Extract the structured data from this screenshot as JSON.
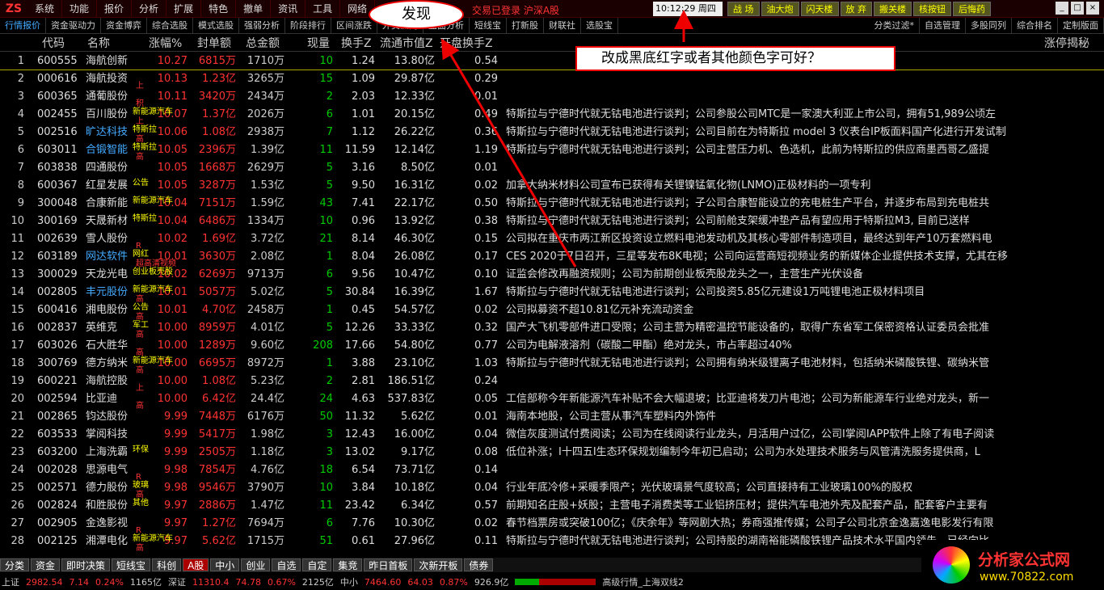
{
  "menu": {
    "logo": "ZS",
    "items": [
      "系统",
      "功能",
      "报价",
      "分析",
      "扩展",
      "特色",
      "撤单",
      "资讯",
      "工具",
      "网络"
    ],
    "login_status": "交易已登录  沪深A股",
    "clock": "10:12:29 周四",
    "quick_buttons": [
      "战 场",
      "油大炮",
      "闪天楼",
      "放 弃",
      "搬关楼",
      "核按钮",
      "后悔药"
    ]
  },
  "tabs": {
    "left": [
      "行情报价",
      "资金驱动力",
      "资金博弈",
      "综合选股",
      "模式选股",
      "强弱分析",
      "阶段排行",
      "区间涨跌",
      "外资流向",
      "盘面分析",
      "短线宝",
      "打新股",
      "财联社",
      "选股宝"
    ],
    "right": [
      "分类过滤*",
      "自选管理",
      "多股同列",
      "综合排名",
      "定制版面"
    ]
  },
  "columns": [
    "代码",
    "名称",
    "涨幅%",
    "封单额",
    "总金额",
    "现量",
    "换手Z",
    "流通市值Z",
    "开盘换手Z",
    "涨停揭秘"
  ],
  "rows": [
    {
      "idx": "1",
      "code": "600555",
      "name": "海航创新",
      "pct": "10.27",
      "seal": "6815万",
      "amt": "1710万",
      "vol": "10",
      "turn": "1.24",
      "mcap": "13.80亿",
      "open": "0.54",
      "note": "",
      "tag": "",
      "tag2": "",
      "name_color": "#ddd"
    },
    {
      "idx": "2",
      "code": "000616",
      "name": "海航投资",
      "pct": "10.13",
      "seal": "1.23亿",
      "amt": "3265万",
      "vol": "15",
      "turn": "1.09",
      "mcap": "29.87亿",
      "open": "0.29",
      "note": "",
      "tag": "",
      "tag2": "上",
      "name_color": "#ddd"
    },
    {
      "idx": "3",
      "code": "600365",
      "name": "通葡股份",
      "pct": "10.11",
      "seal": "3420万",
      "amt": "2434万",
      "vol": "2",
      "turn": "2.03",
      "mcap": "12.33亿",
      "open": "0.01",
      "note": "",
      "tag": "",
      "tag2": "积",
      "name_color": "#ddd"
    },
    {
      "idx": "4",
      "code": "002455",
      "name": "百川股份",
      "pct": "10.07",
      "seal": "1.37亿",
      "amt": "2026万",
      "vol": "6",
      "turn": "1.01",
      "mcap": "20.15亿",
      "open": "0.49",
      "note": "特斯拉与宁德时代就无钴电池进行谈判；公司参股公司MTC是一家澳大利亚上市公司，拥有51,989公顷左",
      "tag": "新能源汽车",
      "tag2": "上",
      "name_color": "#ddd"
    },
    {
      "idx": "5",
      "code": "002516",
      "name": "旷达科技",
      "pct": "10.06",
      "seal": "1.08亿",
      "amt": "2938万",
      "vol": "7",
      "turn": "1.12",
      "mcap": "26.22亿",
      "open": "0.36",
      "note": "特斯拉与宁德时代就无钴电池进行谈判；公司目前在为特斯拉 model 3 仪表台IP板面料国产化进行开发试制",
      "tag": "特斯拉",
      "tag2": "高",
      "name_color": "#4af"
    },
    {
      "idx": "6",
      "code": "603011",
      "name": "合锻智能",
      "pct": "10.05",
      "seal": "2396万",
      "amt": "1.39亿",
      "vol": "11",
      "turn": "11.59",
      "mcap": "12.14亿",
      "open": "1.19",
      "note": "特斯拉与宁德时代就无钴电池进行谈判；公司主营压力机、色选机，此前为特斯拉的供应商墨西哥乙盛提",
      "tag": "特斯拉",
      "tag2": "高",
      "name_color": "#4af"
    },
    {
      "idx": "7",
      "code": "603838",
      "name": "四通股份",
      "pct": "10.05",
      "seal": "1668万",
      "amt": "2629万",
      "vol": "5",
      "turn": "3.16",
      "mcap": "8.50亿",
      "open": "0.01",
      "note": "",
      "tag": "",
      "tag2": "",
      "name_color": "#ddd"
    },
    {
      "idx": "8",
      "code": "600367",
      "name": "红星发展",
      "pct": "10.05",
      "seal": "3287万",
      "amt": "1.53亿",
      "vol": "5",
      "turn": "9.50",
      "mcap": "16.31亿",
      "open": "0.02",
      "note": "加拿大纳米材料公司宣布已获得有关锂镍锰氧化物(LNMO)正极材料的一项专利",
      "tag": "公告",
      "tag2": "",
      "name_color": "#ddd"
    },
    {
      "idx": "9",
      "code": "300048",
      "name": "合康新能",
      "pct": "10.04",
      "seal": "7151万",
      "amt": "1.59亿",
      "vol": "43",
      "turn": "7.41",
      "mcap": "22.17亿",
      "open": "0.50",
      "note": "特斯拉与宁德时代就无钴电池进行谈判；子公司合康智能设立的充电桩生产平台，并逐步布局到充电桩共",
      "tag": "新能源汽车",
      "tag2": "",
      "name_color": "#ddd"
    },
    {
      "idx": "10",
      "code": "300169",
      "name": "天晟新材",
      "pct": "10.04",
      "seal": "6486万",
      "amt": "1334万",
      "vol": "10",
      "turn": "0.96",
      "mcap": "13.92亿",
      "open": "0.38",
      "note": "特斯拉与宁德时代就无钴电池进行谈判；公司前舱支架缓冲垫产品有望应用于特斯拉M3, 目前已送样",
      "tag": "特斯拉",
      "tag2": "",
      "name_color": "#ddd"
    },
    {
      "idx": "11",
      "code": "002639",
      "name": "雪人股份",
      "pct": "10.02",
      "seal": "1.69亿",
      "amt": "3.72亿",
      "vol": "21",
      "turn": "8.14",
      "mcap": "46.30亿",
      "open": "0.15",
      "note": "公司拟在重庆市两江新区投资设立燃料电池发动机及其核心零部件制造项目，最终达到年产10万套燃料电",
      "tag": "",
      "tag2": "R",
      "name_color": "#ddd"
    },
    {
      "idx": "12",
      "code": "603189",
      "name": "网达软件",
      "pct": "10.01",
      "seal": "3630万",
      "amt": "2.08亿",
      "vol": "1",
      "turn": "8.04",
      "mcap": "26.08亿",
      "open": "0.17",
      "note": "CES 2020于7日召开，三星等发布8K电视；公司向运营商短视频业务的新媒体企业提供技术支撑，尤其在移",
      "tag": "网红",
      "tag2": "超高清视频",
      "name_color": "#4af"
    },
    {
      "idx": "13",
      "code": "300029",
      "name": "天龙光电",
      "pct": "10.02",
      "seal": "6269万",
      "amt": "9713万",
      "vol": "6",
      "turn": "9.56",
      "mcap": "10.47亿",
      "open": "0.10",
      "note": "证监会修改再融资规则；公司为前期创业板壳股龙头之一，主营生产光伏设备",
      "tag": "创业板壳股",
      "tag2": "",
      "name_color": "#ddd"
    },
    {
      "idx": "14",
      "code": "002805",
      "name": "丰元股份",
      "pct": "10.01",
      "seal": "5057万",
      "amt": "5.02亿",
      "vol": "5",
      "turn": "30.84",
      "mcap": "16.39亿",
      "open": "1.67",
      "note": "特斯拉与宁德时代就无钴电池进行谈判；公司投资5.85亿元建设1万吨锂电池正极材料项目",
      "tag": "新能源汽车",
      "tag2": "高",
      "name_color": "#4af"
    },
    {
      "idx": "15",
      "code": "600416",
      "name": "湘电股份",
      "pct": "10.01",
      "seal": "4.70亿",
      "amt": "2458万",
      "vol": "1",
      "turn": "0.45",
      "mcap": "54.57亿",
      "open": "0.02",
      "note": "公司拟募资不超10.81亿元补充流动资金",
      "tag": "公告",
      "tag2": "高",
      "name_color": "#ddd"
    },
    {
      "idx": "16",
      "code": "002837",
      "name": "英维克",
      "pct": "10.00",
      "seal": "8959万",
      "amt": "4.01亿",
      "vol": "5",
      "turn": "12.26",
      "mcap": "33.33亿",
      "open": "0.32",
      "note": "国产大飞机零部件进口受限；公司主营为精密温控节能设备的，取得广东省军工保密资格认证委员会批准",
      "tag": "军工",
      "tag2": "高",
      "name_color": "#ddd"
    },
    {
      "idx": "17",
      "code": "603026",
      "name": "石大胜华",
      "pct": "10.00",
      "seal": "1289万",
      "amt": "9.60亿",
      "vol": "208",
      "turn": "17.66",
      "mcap": "54.80亿",
      "open": "0.77",
      "note": "公司为电解液溶剂（碳酸二甲酯）绝对龙头，市占率超过40%",
      "tag": "",
      "tag2": "高",
      "name_color": "#ddd"
    },
    {
      "idx": "18",
      "code": "300769",
      "name": "德方纳米",
      "pct": "10.00",
      "seal": "6695万",
      "amt": "8972万",
      "vol": "1",
      "turn": "3.88",
      "mcap": "23.10亿",
      "open": "1.03",
      "note": "特斯拉与宁德时代就无钴电池进行谈判；公司拥有纳米级锂离子电池材料，包括纳米磷酸铁锂、碳纳米管",
      "tag": "新能源汽车",
      "tag2": "高",
      "name_color": "#ddd"
    },
    {
      "idx": "19",
      "code": "600221",
      "name": "海航控股",
      "pct": "10.00",
      "seal": "1.08亿",
      "amt": "5.23亿",
      "vol": "2",
      "turn": "2.81",
      "mcap": "186.51亿",
      "open": "0.24",
      "note": "",
      "tag": "",
      "tag2": "上",
      "name_color": "#ddd"
    },
    {
      "idx": "20",
      "code": "002594",
      "name": "比亚迪",
      "pct": "10.00",
      "seal": "6.42亿",
      "amt": "24.4亿",
      "vol": "24",
      "turn": "4.63",
      "mcap": "537.83亿",
      "open": "0.05",
      "note": "工信部称今年新能源汽车补贴不会大幅退坡；比亚迪将发刀片电池；公司为新能源车行业绝对龙头，新一",
      "tag": "",
      "tag2": "高",
      "name_color": "#ddd"
    },
    {
      "idx": "21",
      "code": "002865",
      "name": "钧达股份",
      "pct": "9.99",
      "seal": "7448万",
      "amt": "6176万",
      "vol": "50",
      "turn": "11.32",
      "mcap": "5.62亿",
      "open": "0.01",
      "note": "海南本地股，公司主营从事汽车塑料内外饰件",
      "tag": "",
      "tag2": "",
      "name_color": "#ddd"
    },
    {
      "idx": "22",
      "code": "603533",
      "name": "掌阅科技",
      "pct": "9.99",
      "seal": "5417万",
      "amt": "1.98亿",
      "vol": "3",
      "turn": "12.43",
      "mcap": "16.00亿",
      "open": "0.04",
      "note": "微信灰度测试付费阅读；公司为在线阅读行业龙头，月活用户过亿，公司I掌阅IAPP软件上除了有电子阅读",
      "tag": "",
      "tag2": "",
      "name_color": "#ddd"
    },
    {
      "idx": "23",
      "code": "603200",
      "name": "上海洗霸",
      "pct": "9.99",
      "seal": "2505万",
      "amt": "1.18亿",
      "vol": "3",
      "turn": "13.02",
      "mcap": "9.17亿",
      "open": "0.08",
      "note": "低位补涨；I十四五I生态环保规划编制今年初已启动；公司为水处理技术服务与风管清洗服务提供商，L",
      "tag": "环保",
      "tag2": "",
      "name_color": "#ddd"
    },
    {
      "idx": "24",
      "code": "002028",
      "name": "思源电气",
      "pct": "9.98",
      "seal": "7854万",
      "amt": "4.76亿",
      "vol": "18",
      "turn": "6.54",
      "mcap": "73.71亿",
      "open": "0.14",
      "note": "",
      "tag": "",
      "tag2": "R",
      "name_color": "#ddd"
    },
    {
      "idx": "25",
      "code": "002571",
      "name": "德力股份",
      "pct": "9.98",
      "seal": "9546万",
      "amt": "3790万",
      "vol": "10",
      "turn": "3.84",
      "mcap": "10.18亿",
      "open": "0.04",
      "note": "行业年底冷修+采暖季限产；光伏玻璃景气度较高；公司直接持有工业玻璃100%的股权",
      "tag": "玻璃",
      "tag2": "高",
      "name_color": "#ddd"
    },
    {
      "idx": "26",
      "code": "002824",
      "name": "和胜股份",
      "pct": "9.97",
      "seal": "2886万",
      "amt": "1.47亿",
      "vol": "11",
      "turn": "23.42",
      "mcap": "6.34亿",
      "open": "0.57",
      "note": "前期知名庄股+妖股；主营电子消费类等工业铝挤压材；提供汽车电池外壳及配套产品，配套客户主要有",
      "tag": "其他",
      "tag2": "",
      "name_color": "#ddd"
    },
    {
      "idx": "27",
      "code": "002905",
      "name": "金逸影视",
      "pct": "9.97",
      "seal": "1.27亿",
      "amt": "7694万",
      "vol": "6",
      "turn": "7.76",
      "mcap": "10.30亿",
      "open": "0.02",
      "note": "春节档票房或突破100亿；《庆余年》等网剧大热；券商强推传媒；公司子公司北京金逸嘉逸电影发行有限",
      "tag": "",
      "tag2": "R",
      "name_color": "#ddd"
    },
    {
      "idx": "28",
      "code": "002125",
      "name": "湘潭电化",
      "pct": "9.97",
      "seal": "5.62亿",
      "amt": "1715万",
      "vol": "51",
      "turn": "0.61",
      "mcap": "27.96亿",
      "open": "0.11",
      "note": "特斯拉与宁德时代就无钴电池进行谈判；公司持股的湖南裕能磷酸铁锂产品技术水平国内领先，已经向比",
      "tag": "新能源汽车",
      "tag2": "高",
      "name_color": "#ddd"
    }
  ],
  "footer_tabs": [
    "分类",
    "资金",
    "即时决策",
    "短线宝",
    "科创",
    "A股",
    "中小",
    "创业",
    "自选",
    "自定",
    "集竞",
    "昨日首板",
    "次新开板",
    "债券"
  ],
  "footer_active": "A股",
  "status": {
    "sh_label": "上证",
    "sh_val": "2982.54",
    "sh_chg": "7.14",
    "sh_pct": "0.24%",
    "sh_amt": "1165亿",
    "sz_label": "深证",
    "sz_val": "11310.4",
    "sz_chg": "74.78",
    "sz_pct": "0.67%",
    "sz_amt": "2125亿",
    "zx_label": "中小",
    "zx_val": "7464.60",
    "zx_chg": "64.03",
    "zx_pct": "0.87%",
    "zx_amt": "926.9亿",
    "feed": "高级行情_上海双线2"
  },
  "annotations": {
    "oval": "发现",
    "box": "改成黑底红字或者其他颜色字可好？"
  },
  "watermark": {
    "title": "分析家公式网",
    "url": "www.70822.com"
  },
  "colors": {
    "up": "#ff3333",
    "bg": "#000000",
    "link": "#44aaff"
  }
}
